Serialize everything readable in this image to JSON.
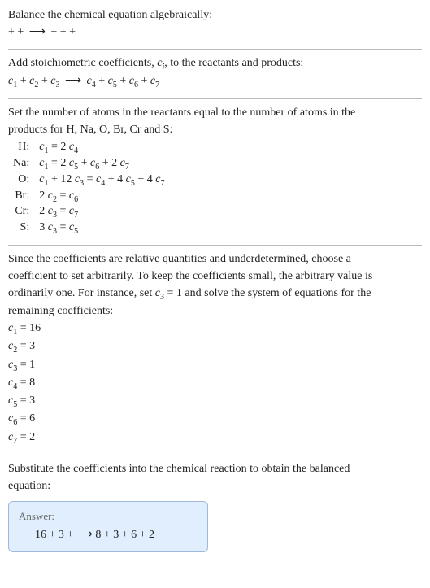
{
  "intro": {
    "l1": "Balance the chemical equation algebraically:",
    "l2_left": " +  + ",
    "l2_arrow": "⟶",
    "l2_right": " +  +  + "
  },
  "step1": {
    "text": "Add stoichiometric coefficients, ",
    "ci": "c",
    "ci_sub": "i",
    "text2": ", to the reactants and products:",
    "eq_c1": "c",
    "eq_c1s": "1",
    "eq_c2": "c",
    "eq_c2s": "2",
    "eq_c3": "c",
    "eq_c3s": "3",
    "eq_arrow": "⟶",
    "eq_c4": "c",
    "eq_c4s": "4",
    "eq_c5": "c",
    "eq_c5s": "5",
    "eq_c6": "c",
    "eq_c6s": "6",
    "eq_c7": "c",
    "eq_c7s": "7"
  },
  "step2": {
    "text1": "Set the number of atoms in the reactants equal to the number of atoms in the",
    "text2": "products for H, Na, O, Br, Cr and S:",
    "rows": {
      "H": {
        "label": "H:",
        "c": "c",
        "s1": "1",
        "eq": " = 2 ",
        "c2": "c",
        "s2": "4"
      },
      "Na": {
        "label": "Na:",
        "c": "c",
        "s1": "1",
        "eq": " = 2 ",
        "c2": "c",
        "s2": "5",
        "p": " + ",
        "c3": "c",
        "s3": "6",
        "p2": " + 2 ",
        "c4": "c",
        "s4": "7"
      },
      "O": {
        "label": "O:",
        "c": "c",
        "s1": "1",
        "eq": " + 12 ",
        "c2": "c",
        "s2": "3",
        "p": " = ",
        "c3": "c",
        "s3": "4",
        "p2": " + 4 ",
        "c4": "c",
        "s4": "5",
        "p3": " + 4 ",
        "c5": "c",
        "s5": "7"
      },
      "Br": {
        "label": "Br:",
        "pre": "2 ",
        "c": "c",
        "s1": "2",
        "eq": " = ",
        "c2": "c",
        "s2": "6"
      },
      "Cr": {
        "label": "Cr:",
        "pre": "2 ",
        "c": "c",
        "s1": "3",
        "eq": " = ",
        "c2": "c",
        "s2": "7"
      },
      "S": {
        "label": "S:",
        "pre": "3 ",
        "c": "c",
        "s1": "3",
        "eq": " = ",
        "c2": "c",
        "s2": "5"
      }
    }
  },
  "step3": {
    "t1": "Since the coefficients are relative quantities and underdetermined, choose a",
    "t2": "coefficient to set arbitrarily. To keep the coefficients small, the arbitrary value is",
    "t3a": "ordinarily one. For instance, set ",
    "t3c": "c",
    "t3s": "3",
    "t3b": " = 1 and solve the system of equations for the",
    "t4": "remaining coefficients:",
    "sol": [
      {
        "c": "c",
        "s": "1",
        "v": " = 16"
      },
      {
        "c": "c",
        "s": "2",
        "v": " = 3"
      },
      {
        "c": "c",
        "s": "3",
        "v": " = 1"
      },
      {
        "c": "c",
        "s": "4",
        "v": " = 8"
      },
      {
        "c": "c",
        "s": "5",
        "v": " = 3"
      },
      {
        "c": "c",
        "s": "6",
        "v": " = 6"
      },
      {
        "c": "c",
        "s": "7",
        "v": " = 2"
      }
    ]
  },
  "step4": {
    "t1": "Substitute the coefficients into the chemical reaction to obtain the balanced",
    "t2": "equation:"
  },
  "answer": {
    "hdr": "Answer:",
    "final_left": "16  + 3  + ",
    "final_arrow": " ⟶ ",
    "final_right": "8  + 3  + 6  + 2 "
  }
}
